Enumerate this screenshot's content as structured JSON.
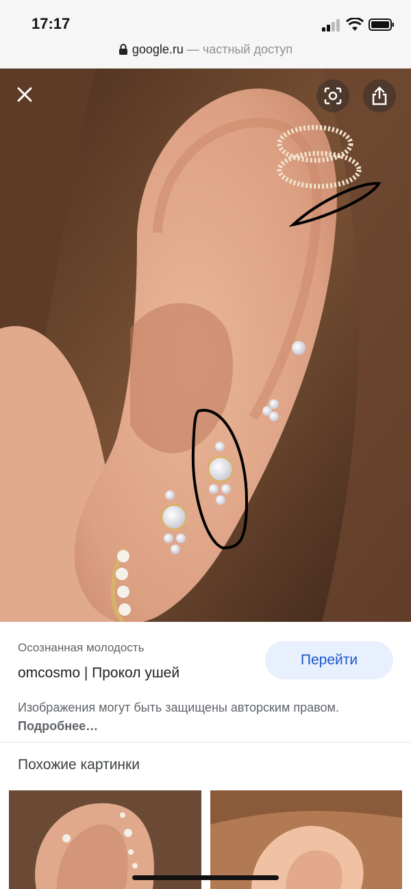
{
  "status_bar": {
    "time": "17:17"
  },
  "address_bar": {
    "domain": "google.ru",
    "suffix": "— частный доступ"
  },
  "viewer": {
    "close_icon": "close-icon",
    "lens_icon": "lens-icon",
    "share_icon": "share-icon"
  },
  "result": {
    "source": "Осознанная молодость",
    "title": "omcosmo | Прокол ушей",
    "go_label": "Перейти",
    "copyright_text": "Изображения могут быть защищены авторским правом.",
    "more_label": "Подробнее…"
  },
  "similar": {
    "heading": "Похожие картинки"
  },
  "colors": {
    "accent": "#1a57c7",
    "button_bg": "#e8f0fe"
  }
}
